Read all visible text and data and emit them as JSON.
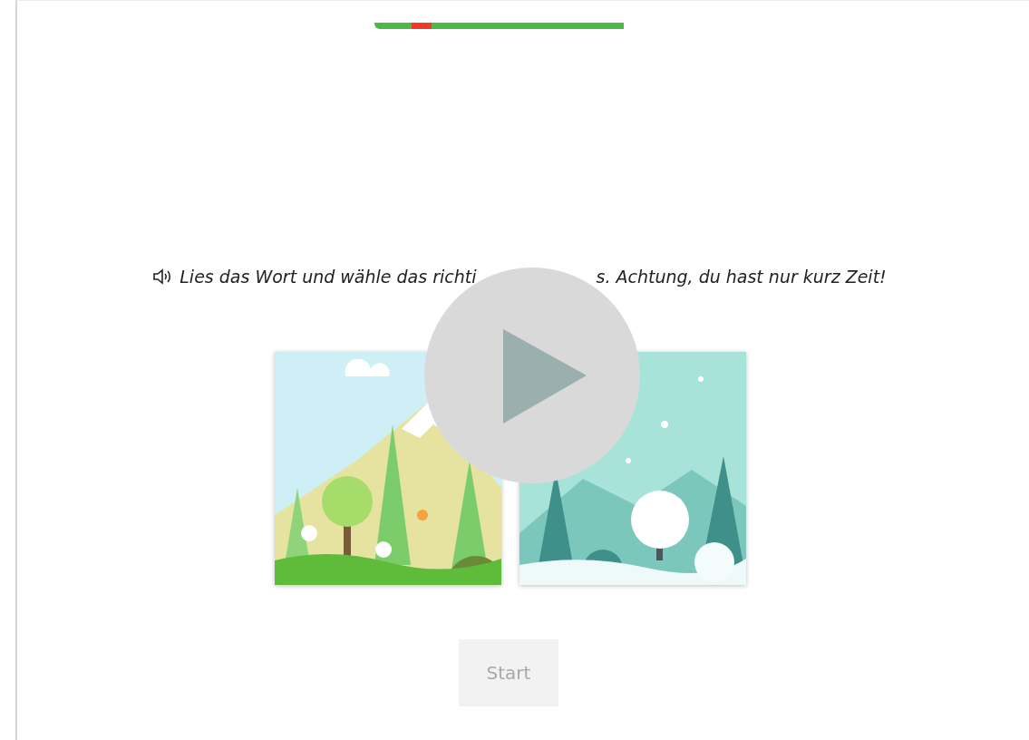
{
  "progress": {
    "segments": [
      {
        "color": "#4cb848"
      },
      {
        "color": "#f0392b"
      },
      {
        "color": "#4cb848"
      }
    ]
  },
  "instruction": {
    "parts": [
      "Lies das Wort und wähle das richti",
      "s. Achtung, du hast nur kurz Zeit!"
    ]
  },
  "video_overlay": {
    "kind": "play"
  },
  "start_button": {
    "label": "Start",
    "disabled": true
  }
}
